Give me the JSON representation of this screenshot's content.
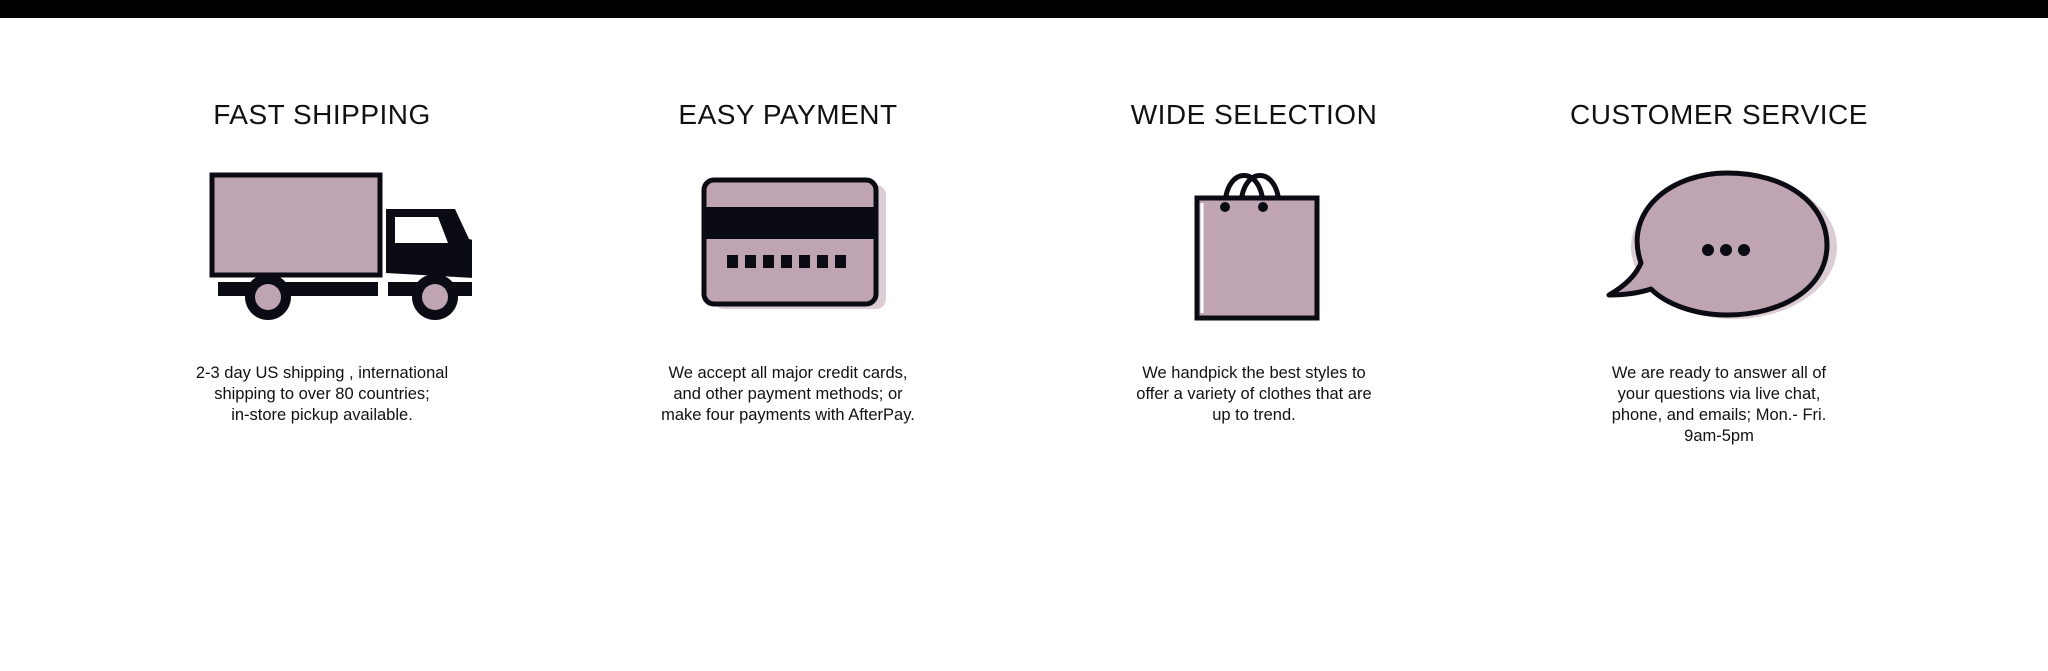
{
  "colors": {
    "accent": "#bfa5b2",
    "accent_light": "#dccdd4",
    "outline": "#0b0b14",
    "top_bar": "#000000"
  },
  "features": [
    {
      "title": "FAST SHIPPING",
      "icon": "truck-icon",
      "description": [
        "2-3 day US shipping , international",
        "shipping to over 80 countries;",
        "in-store pickup available."
      ]
    },
    {
      "title": "EASY PAYMENT",
      "icon": "credit-card-icon",
      "description": [
        "We accept all major credit cards,",
        "and other payment methods; or",
        "make four payments with AfterPay."
      ]
    },
    {
      "title": "WIDE SELECTION",
      "icon": "shopping-bag-icon",
      "description": [
        "We handpick the best styles to",
        "offer a variety of clothes that are",
        "up to trend."
      ]
    },
    {
      "title": "CUSTOMER SERVICE",
      "icon": "chat-bubble-icon",
      "description": [
        "We are ready to answer all of",
        "your questions via live chat,",
        "phone, and emails; Mon.- Fri.",
        "9am-5pm"
      ]
    }
  ]
}
